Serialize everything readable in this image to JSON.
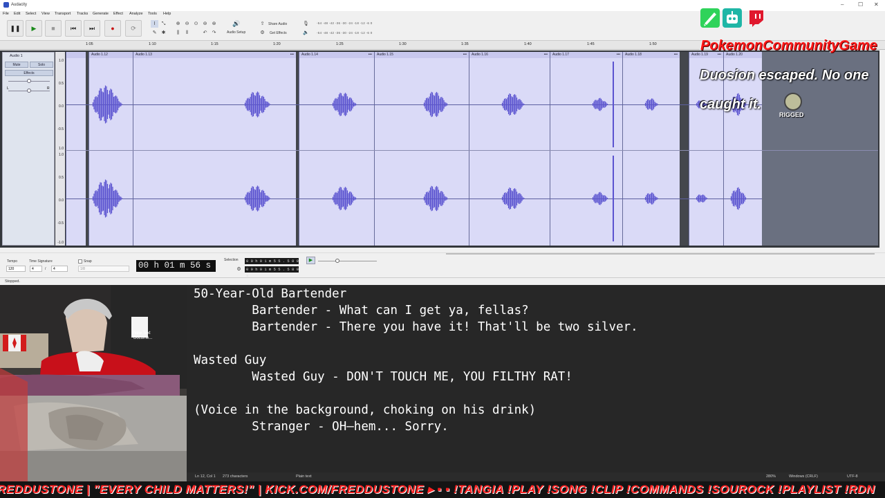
{
  "window": {
    "title": "Audacity",
    "controls": [
      "–",
      "☐",
      "✕"
    ]
  },
  "menu": [
    "File",
    "Edit",
    "Select",
    "View",
    "Transport",
    "Tracks",
    "Generate",
    "Effect",
    "Analyze",
    "Tools",
    "Help"
  ],
  "toolbar": {
    "audio_setup_label": "Audio Setup",
    "share_audio_label": "Share Audio",
    "get_effects_label": "Get Effects",
    "meter_scale": "-54 -48 -42 -36 -30 -24 -18 -12 -6 0"
  },
  "ruler": {
    "ticks": [
      "1:05",
      "1:10",
      "1:15",
      "1:20",
      "1:25",
      "1:30",
      "1:35",
      "1:40",
      "1:45",
      "1:50"
    ]
  },
  "track": {
    "name": "Audio 1",
    "mute_label": "Mute",
    "solo_label": "Solo",
    "effects_label": "Effects",
    "gain_left": "L",
    "gain_right": "R",
    "scale": [
      "1.0",
      "0.5",
      "0.0",
      "-0.5",
      "-1.0"
    ],
    "clips": [
      "Audio 1.12",
      "Audio 1.13",
      "Audio 1.14",
      "Audio 1.15",
      "Audio 1.16",
      "Audio 1.17",
      "Audio 1.18",
      "Audio 1.19",
      "Audio 1.20"
    ],
    "accent_color": "#5a52d0"
  },
  "bottom": {
    "tempo_label": "Tempo",
    "tempo_value": "120",
    "time_sig_label": "Time Signature",
    "time_sig_num": "4",
    "time_sig_den": "4",
    "snap_label": "Snap",
    "snap_value": "1/8",
    "time_display": "00 h 01 m 56 s",
    "selection_label": "Selection",
    "sel_start": "0 0 h 0 1 m 5 5 . 5 8 9 s",
    "sel_end": "0 0 h 0 1 m 5 5 . 5 8 9 s"
  },
  "status": {
    "text": "Stopped."
  },
  "overlay": {
    "brand": "PokemonCommunityGame",
    "message_line1": "Duosion escaped. No one",
    "message_line2": "caught it.",
    "badge_text": "RIGGED"
  },
  "desktop_icon": {
    "label_line1": "New Text",
    "label_line2": "Docume..."
  },
  "notepad": {
    "lines": [
      "50-Year-Old Bartender",
      "        Bartender - What can I get ya, fellas?",
      "        Bartender - There you have it! That'll be two silver.",
      "",
      "Wasted Guy",
      "        Wasted Guy - DON'T TOUCH ME, YOU FILTHY RAT!",
      "",
      "(Voice in the background, choking on his drink)",
      "        Stranger - OH—hem... Sorry."
    ],
    "status_position": "Ln 12, Col 1",
    "status_chars": "273 characters",
    "status_format": "Plain text",
    "status_zoom": "280%",
    "status_eol": "Windows (CRLF)",
    "status_encoding": "UTF-8"
  },
  "ticker": {
    "text": "REDDUSTONE  |  \"EVERY CHILD MATTERS!\"  |  KICK.COM/FREDDUSTONE  ▸ ▪ ▪  !TANGIA  !PLAY  !SONG  !CLIP  !COMMANDS  !SOUROCK  !PLAYLIST  !RDN"
  }
}
